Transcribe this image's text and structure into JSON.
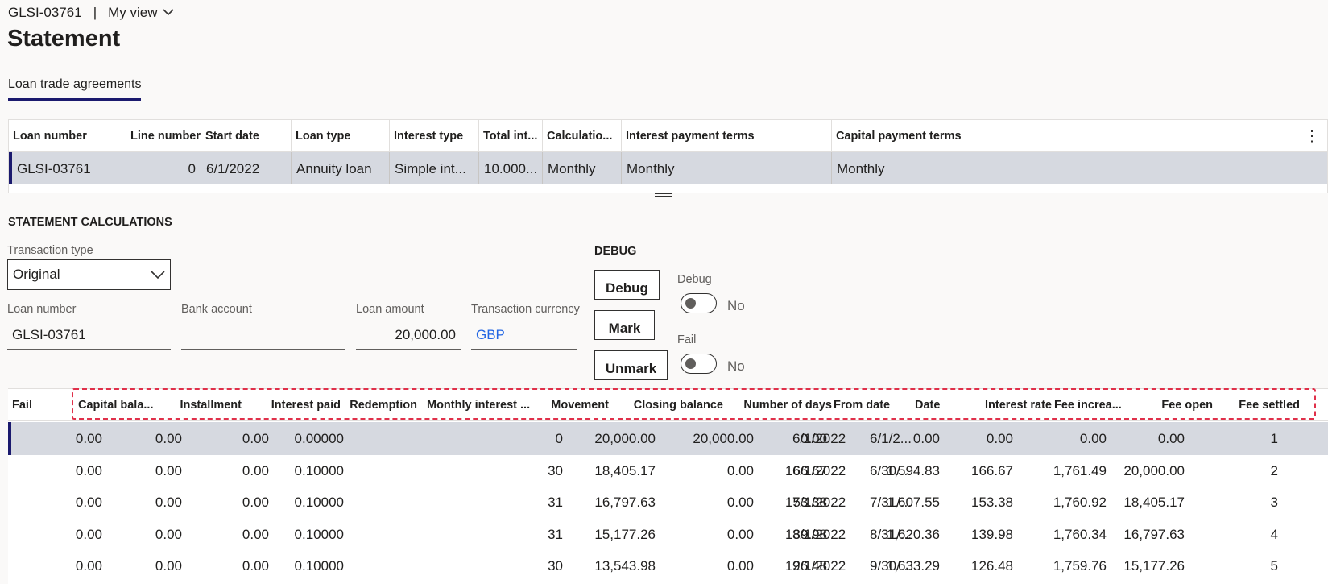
{
  "header": {
    "record_id": "GLSI-03761",
    "separator": "|",
    "view_label": "My view",
    "title": "Statement",
    "tab_label": "Loan trade agreements"
  },
  "top_grid": {
    "columns": [
      "Loan number",
      "Line number",
      "Start date",
      "Loan type",
      "Interest type",
      "Total int...",
      "Calculatio...",
      "Interest payment terms",
      "Capital payment terms"
    ],
    "row": [
      "GLSI-03761",
      "0",
      "6/1/2022",
      "Annuity loan",
      "Simple int...",
      "10.000...",
      "Monthly",
      "Monthly",
      "Monthly"
    ],
    "more_icon": "⋮"
  },
  "calc": {
    "section_title": "STATEMENT CALCULATIONS",
    "transaction_type_label": "Transaction type",
    "transaction_type_value": "Original",
    "loan_number_label": "Loan number",
    "loan_number_value": "GLSI-03761",
    "bank_account_label": "Bank account",
    "bank_account_value": "",
    "loan_amount_label": "Loan amount",
    "loan_amount_value": "20,000.00",
    "currency_label": "Transaction currency",
    "currency_value": "GBP"
  },
  "debug": {
    "section_title": "DEBUG",
    "debug_button": "Debug",
    "mark_button": "Mark",
    "unmark_button": "Unmark",
    "debug_toggle_label": "Debug",
    "debug_toggle_value": "No",
    "fail_toggle_label": "Fail",
    "fail_toggle_value": "No"
  },
  "lines_grid": {
    "columns": [
      "Fail",
      "Capital bala...",
      "Installment",
      "Interest paid",
      "Redemption",
      "Monthly interest ...",
      "Movement",
      "Closing balance",
      "Number of days",
      "From date",
      "Date",
      "Interest rate",
      "Fee increa...",
      "Fee open",
      "Fee settled"
    ],
    "rows": [
      [
        "1",
        "0.00",
        "0.00",
        "0.00",
        "0.00",
        "0.00",
        "20,000.00",
        "20,000.00",
        "0",
        "6/1/2022",
        "6/1/2...",
        "0.00000",
        "0.00",
        "0.00",
        "0.00"
      ],
      [
        "2",
        "20,000.00",
        "1,761.49",
        "166.67",
        "1,594.83",
        "166.67",
        "0.00",
        "18,405.17",
        "30",
        "6/1/2022",
        "6/30/...",
        "0.10000",
        "0.00",
        "0.00",
        "0.00"
      ],
      [
        "3",
        "18,405.17",
        "1,760.92",
        "153.38",
        "1,607.55",
        "153.38",
        "0.00",
        "16,797.63",
        "31",
        "7/1/2022",
        "7/31/...",
        "0.10000",
        "0.00",
        "0.00",
        "0.00"
      ],
      [
        "4",
        "16,797.63",
        "1,760.34",
        "139.98",
        "1,620.36",
        "139.98",
        "0.00",
        "15,177.26",
        "31",
        "8/1/2022",
        "8/31/...",
        "0.10000",
        "0.00",
        "0.00",
        "0.00"
      ],
      [
        "5",
        "15,177.26",
        "1,759.76",
        "126.48",
        "1,633.29",
        "126.48",
        "0.00",
        "13,543.98",
        "30",
        "9/1/2022",
        "9/30/...",
        "0.10000",
        "0.00",
        "0.00",
        "0.00"
      ]
    ]
  },
  "colors": {
    "accent": "#1b1a6e",
    "selected_row": "#d6d9e0",
    "highlight": "#e0304a",
    "link": "#2266e3"
  }
}
